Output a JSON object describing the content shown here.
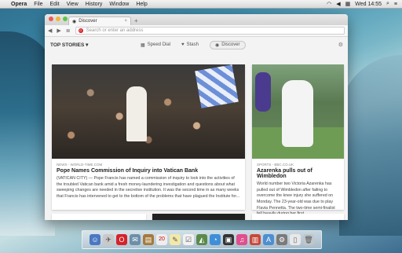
{
  "menubar": {
    "app": "Opera",
    "items": [
      "File",
      "Edit",
      "View",
      "History",
      "Window",
      "Help"
    ],
    "clock": "Wed 14:55"
  },
  "browser": {
    "tab_title": "Discover",
    "address_placeholder": "Search or enter an address",
    "toolbar": {
      "section": "TOP STORIES",
      "speed_dial": "Speed Dial",
      "stash": "Stash",
      "discover": "Discover"
    }
  },
  "stories": [
    {
      "source": "NEWS - WORLD-TIME.COM",
      "headline": "Pope Names Commission of Inquiry into Vatican Bank",
      "summary": "(VATICAN CITY) — Pope Francis has named a commission of inquiry to look into the activities of the troubled Vatican bank amid a fresh money-laundering investigation and questions about what sweeping changes are needed in the secretive institution. It was the second time in as many weeks that Francis has intervened to get to the bottom of the problems that have plagued the Institute for..."
    },
    {
      "source": "SPORTS - BBC.CO.UK",
      "headline": "Azarenka pulls out of Wimbledon",
      "summary": "World number two Victoria Azarenka has pulled out of Wimbledon after failing to overcome the knee injury she suffered on Monday. The 23-year-old was due to play Flavia Pennetta. The two-time semi-finalist fell heavily during her first..."
    }
  ]
}
